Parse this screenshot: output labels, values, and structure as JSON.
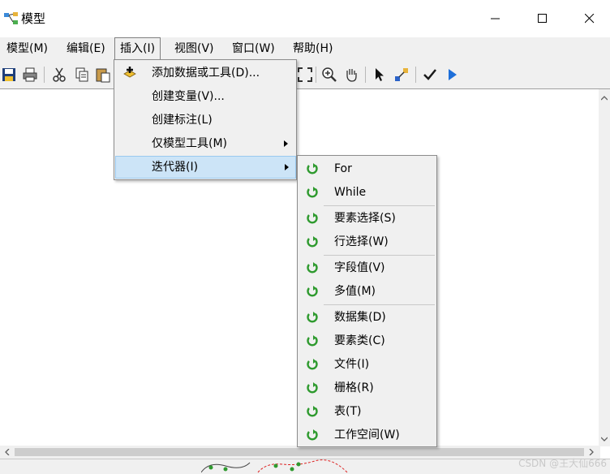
{
  "window": {
    "title": "模型"
  },
  "menubar": {
    "items": [
      {
        "label": "模型(M)"
      },
      {
        "label": "编辑(E)"
      },
      {
        "label": "插入(I)"
      },
      {
        "label": "视图(V)"
      },
      {
        "label": "窗口(W)"
      },
      {
        "label": "帮助(H)"
      }
    ],
    "active": "插入(I)"
  },
  "insert_menu": {
    "items": [
      {
        "label": "添加数据或工具(D)...",
        "icon": "add-data-icon"
      },
      {
        "label": "创建变量(V)..."
      },
      {
        "label": "创建标注(L)"
      },
      {
        "label": "仅模型工具(M)",
        "has_submenu": true
      },
      {
        "label": "迭代器(I)",
        "has_submenu": true,
        "highlighted": true
      }
    ]
  },
  "iterator_submenu": {
    "groups": [
      [
        {
          "label": "For"
        },
        {
          "label": "While"
        }
      ],
      [
        {
          "label": "要素选择(S)"
        },
        {
          "label": "行选择(W)"
        }
      ],
      [
        {
          "label": "字段值(V)"
        },
        {
          "label": "多值(M)"
        }
      ],
      [
        {
          "label": "数据集(D)"
        },
        {
          "label": "要素类(C)"
        },
        {
          "label": "文件(I)"
        },
        {
          "label": "栅格(R)"
        },
        {
          "label": "表(T)"
        },
        {
          "label": "工作空间(W)"
        }
      ]
    ],
    "icon": "iterate-arrow-icon"
  },
  "watermark": "CSDN @王大仙666",
  "colors": {
    "iterator_green": "#2e9a2e",
    "highlight": "#cce4f7",
    "menu_bg": "#f0f0f0"
  }
}
